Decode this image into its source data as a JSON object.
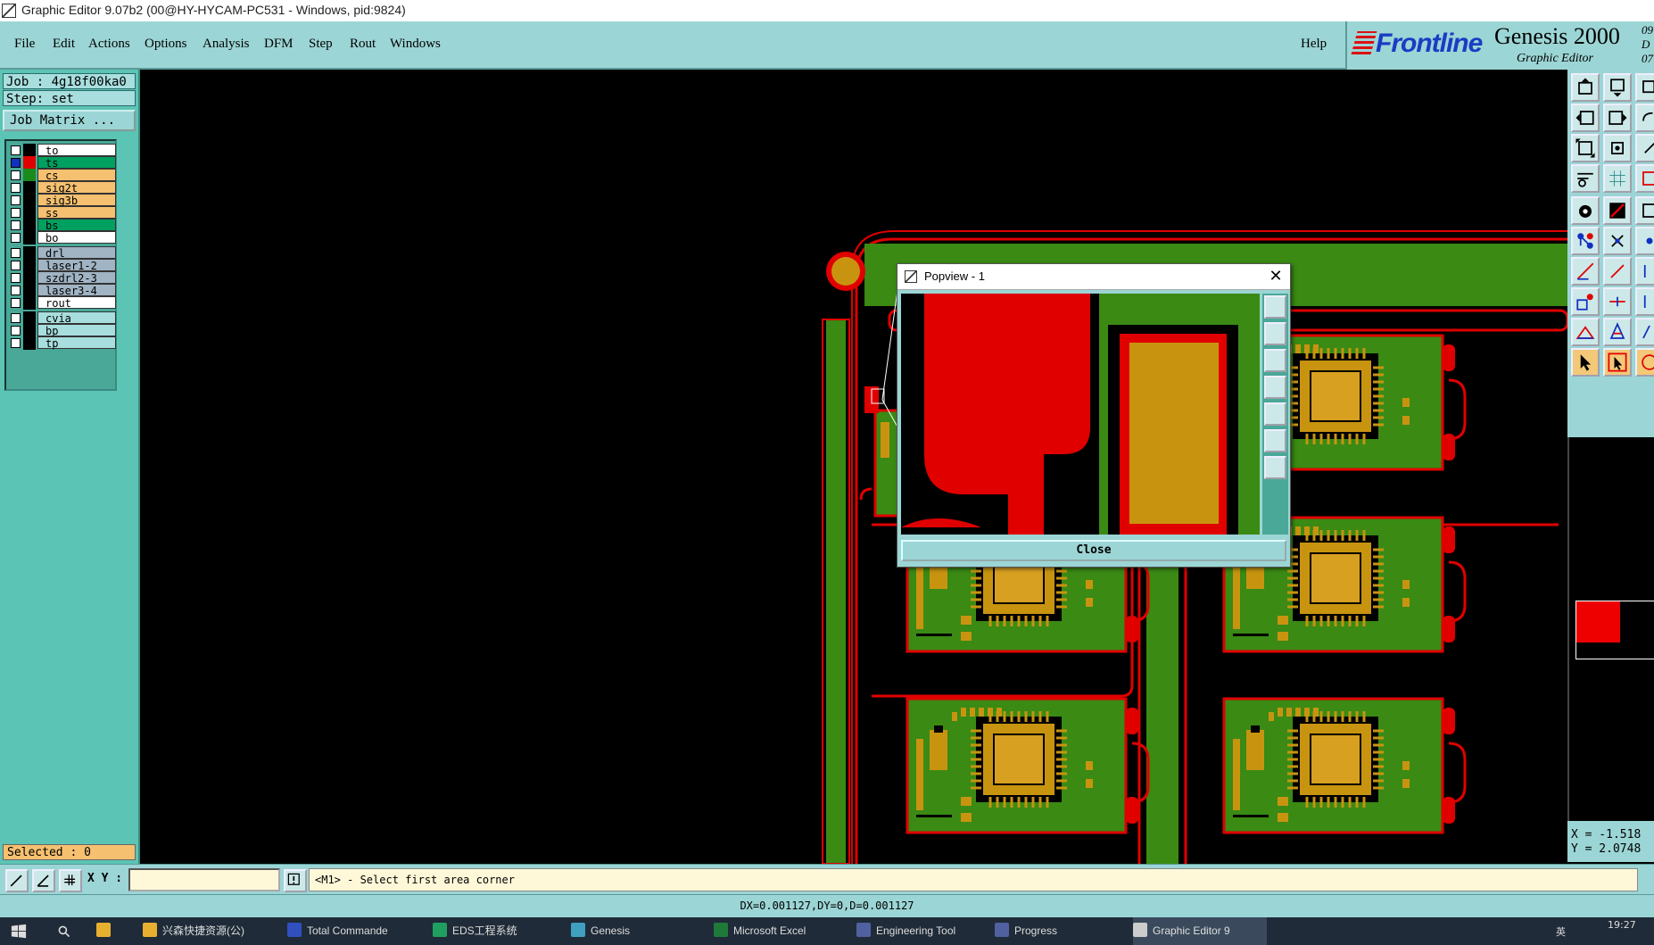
{
  "window": {
    "title": "Graphic Editor 9.07b2 (00@HY-HYCAM-PC531 - Windows, pid:9824)"
  },
  "menu": {
    "items": [
      {
        "label": "File"
      },
      {
        "label": "Edit"
      },
      {
        "label": "Actions"
      },
      {
        "label": "Options"
      },
      {
        "label": "Analysis"
      },
      {
        "label": "DFM"
      },
      {
        "label": "Step"
      },
      {
        "label": "Rout"
      },
      {
        "label": "Windows"
      }
    ],
    "help": "Help"
  },
  "brand": {
    "logo": "Frontline",
    "product": "Genesis 2000",
    "subtitle": "Graphic Editor",
    "date_line1": "09  D",
    "date_line2": "07:"
  },
  "job": {
    "job_label": "Job : 4g18f00ka0",
    "step_label": "Step: set",
    "matrix_button": "Job Matrix ..."
  },
  "layers": [
    {
      "name": "to",
      "color": "#ffffff",
      "swatch": "#000000",
      "checked": false
    },
    {
      "name": "ts",
      "color": "#00a060",
      "swatch": "#e00000",
      "checked": true
    },
    {
      "name": "cs",
      "color": "#f5c070",
      "swatch": "#1a8a1a",
      "checked": false
    },
    {
      "name": "sig2t",
      "color": "#f5c070",
      "swatch": "#000000",
      "checked": false
    },
    {
      "name": "sig3b",
      "color": "#f5c070",
      "swatch": "#000000",
      "checked": false
    },
    {
      "name": "ss",
      "color": "#f5c070",
      "swatch": "#000000",
      "checked": false
    },
    {
      "name": "bs",
      "color": "#00a060",
      "swatch": "#000000",
      "checked": false
    },
    {
      "name": "bo",
      "color": "#ffffff",
      "swatch": "#000000",
      "checked": false
    },
    {
      "name": "drl",
      "color": "#a0b4c4",
      "swatch": "#000000",
      "checked": false
    },
    {
      "name": "laser1-2",
      "color": "#a0b4c4",
      "swatch": "#000000",
      "checked": false
    },
    {
      "name": "szdrl2-3",
      "color": "#a0b4c4",
      "swatch": "#000000",
      "checked": false
    },
    {
      "name": "laser3-4",
      "color": "#a0b4c4",
      "swatch": "#000000",
      "checked": false
    },
    {
      "name": "rout",
      "color": "#ffffff",
      "swatch": "#000000",
      "checked": false
    },
    {
      "name": "cvia",
      "color": "#a8dede",
      "swatch": "#000000",
      "checked": false
    },
    {
      "name": "bp",
      "color": "#a8dede",
      "swatch": "#000000",
      "checked": false
    },
    {
      "name": "tp",
      "color": "#a8dede",
      "swatch": "#000000",
      "checked": false
    }
  ],
  "selected_label": "Selected : 0",
  "popview": {
    "title": "Popview - 1",
    "close_label": "Close"
  },
  "coords": {
    "x": "X = -1.518",
    "y": "Y = 2.0748"
  },
  "command": {
    "xy_label": "X Y :",
    "xy_value": "",
    "prompt": "<M1> - Select first area corner"
  },
  "status": "DX=0.001127,DY=0,D=0.001127",
  "taskbar": {
    "items": [
      {
        "label": "兴森快捷资源(公)",
        "icon_color": "#e8b030"
      },
      {
        "label": "Total Commande",
        "icon_color": "#3050c0"
      },
      {
        "label": "EDS工程系统",
        "icon_color": "#20a060"
      },
      {
        "label": "Genesis",
        "icon_color": "#40a0c0"
      },
      {
        "label": "Microsoft Excel",
        "icon_color": "#1f7a3a"
      },
      {
        "label": "Engineering Tool",
        "icon_color": "#5060a0"
      },
      {
        "label": "Progress",
        "icon_color": "#5060a0"
      },
      {
        "label": "Graphic Editor 9",
        "icon_color": "#cccccc"
      }
    ],
    "time": "19:27",
    "ime": "英"
  },
  "colors": {
    "panel": "#9cd5d5",
    "left_panel": "#5cc4b4",
    "board_green": "#3a8a14",
    "copper": "#c89410",
    "soldermask_red": "#e00000"
  }
}
